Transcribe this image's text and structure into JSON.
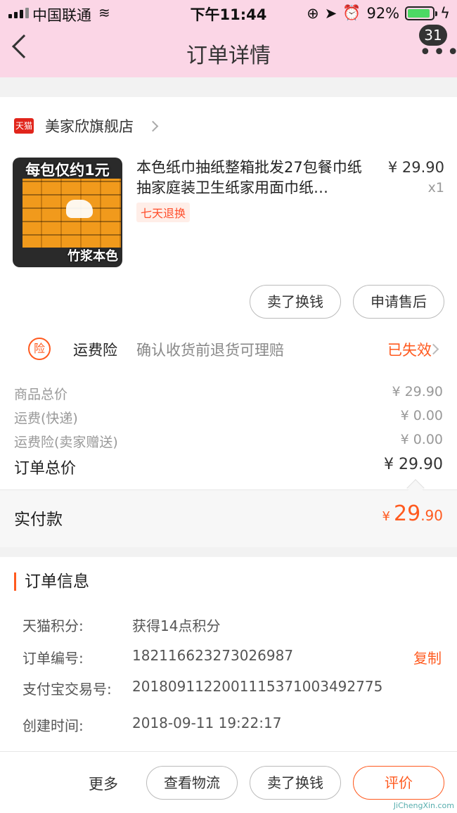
{
  "status_bar": {
    "carrier": "中国联通",
    "time": "下午11:44",
    "battery": "92%",
    "battery_level": 0.92
  },
  "nav": {
    "title": "订单详情",
    "badge_count": "31"
  },
  "shop": {
    "badge": "天猫",
    "name": "美家欣旗舰店"
  },
  "product": {
    "image_top_text": "每包仅约1元",
    "image_bottom_text": "竹浆本色",
    "name": "本色纸巾抽纸整箱批发27包餐巾纸抽家庭装卫生纸家用面巾纸…",
    "price": "¥ 29.90",
    "qty": "x1",
    "tag": "七天退换"
  },
  "item_actions": {
    "sell_label": "卖了换钱",
    "aftersale_label": "申请售后"
  },
  "insurance": {
    "icon_text": "险",
    "name": "运费险",
    "desc": "确认收货前退货可理赔",
    "status": "已失效"
  },
  "summary": {
    "rows": [
      {
        "label": "商品总价",
        "value": "¥ 29.90"
      },
      {
        "label": "运费(快递)",
        "value": "¥ 0.00"
      },
      {
        "label": "运费险(卖家赠送)",
        "value": "¥ 0.00"
      }
    ],
    "total_label": "订单总价",
    "total_value": "¥ 29.90",
    "paid_label": "实付款",
    "paid_currency": "¥",
    "paid_int": "29",
    "paid_dec": ".90"
  },
  "order_info": {
    "title": "订单信息",
    "rows": [
      {
        "label": "天猫积分:",
        "value": "获得14点积分"
      },
      {
        "label": "订单编号:",
        "value": "182116623273026987"
      },
      {
        "label": "支付宝交易号:",
        "value": "2018091122001115371003492775"
      },
      {
        "label": "创建时间:",
        "value": "2018-09-11 19:22:17"
      }
    ],
    "copy_label": "复制"
  },
  "bottom_bar": {
    "more_label": "更多",
    "logistics_label": "查看物流",
    "sell_label": "卖了换钱",
    "evaluate_label": "评价"
  },
  "watermark": "JiChengXin.com"
}
